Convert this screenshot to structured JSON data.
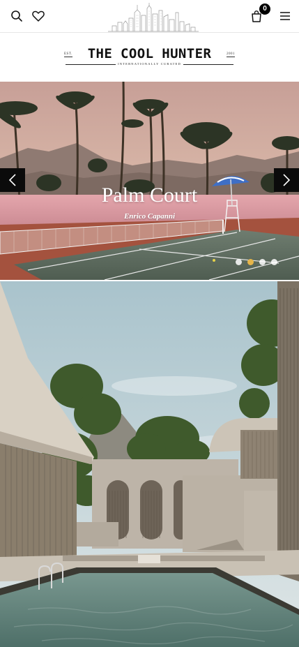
{
  "header": {
    "icons": {
      "search": "search-icon",
      "wishlist": "heart-icon",
      "cart": "bag-icon",
      "menu": "hamburger-icon",
      "logo_art": "city-skyline-icon"
    },
    "cart_count": "0"
  },
  "brand": {
    "est_left": "EST.",
    "title": "THE COOL HUNTER",
    "est_right": "2001",
    "tagline": "INTERNATIONALLY CURATED"
  },
  "slider": {
    "title": "Palm Court",
    "author": "Enrico Capanni",
    "dot_count": 4,
    "active_dot": 2,
    "colors": {
      "active_dot": "#e6b54a",
      "arrow_bg": "#0b0b0b"
    }
  },
  "feature": {
    "image": "modernist-concrete-courtyard-with-pool"
  }
}
